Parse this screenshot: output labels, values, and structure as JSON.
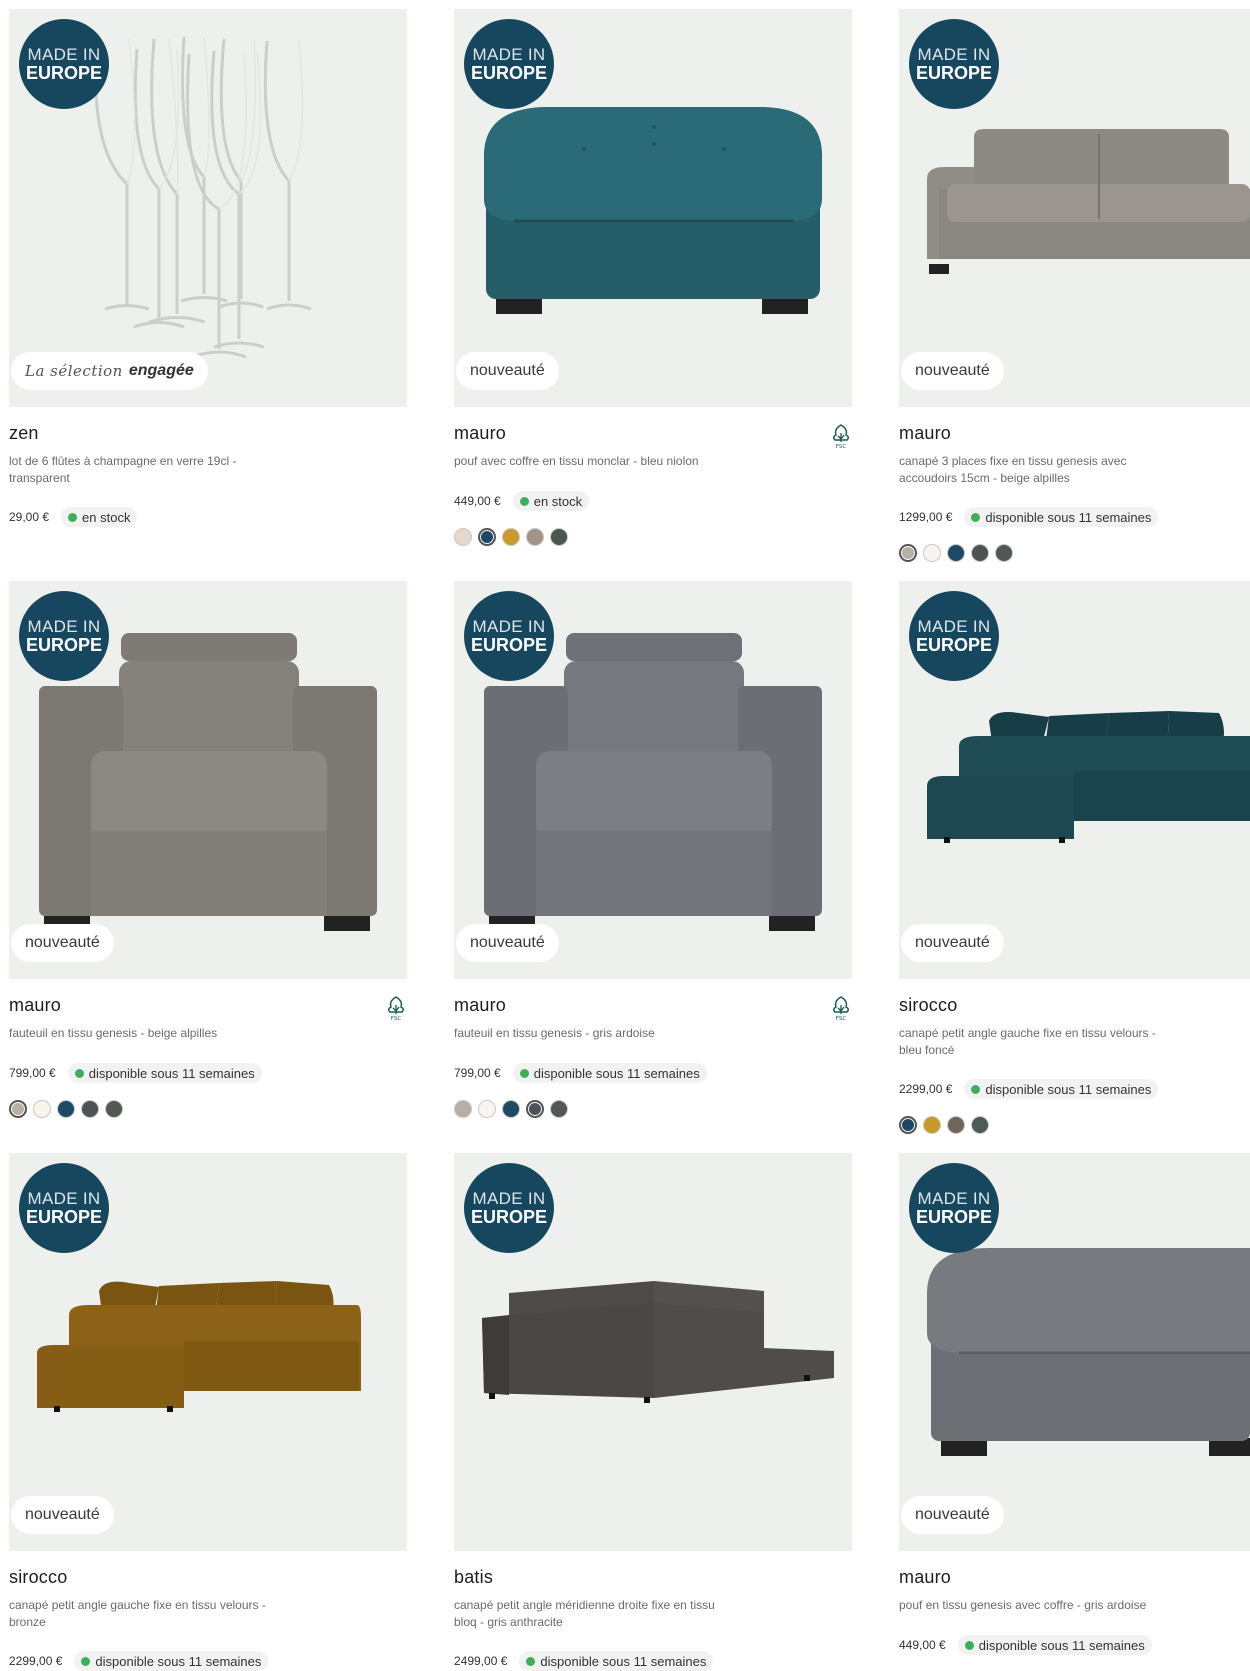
{
  "badges": {
    "europe_line1": "MADE IN",
    "europe_line2": "EUROPE",
    "new": "nouveauté",
    "selection_script": "La sélection",
    "selection_bold": "engagée"
  },
  "products": [
    {
      "name": "zen",
      "desc": "lot de 6 flûtes à champagne en verre 19cl - transparent",
      "price": "29,00 €",
      "availability": "en stock",
      "swatches": []
    },
    {
      "name": "mauro",
      "desc": "pouf avec coffre en tissu monclar - bleu niolon",
      "price": "449,00 €",
      "availability": "en stock",
      "swatches": [
        "#e6d7cc",
        "#1e4865",
        "#c99a2c",
        "#a39586",
        "#4d5550"
      ]
    },
    {
      "name": "mauro",
      "desc": "canapé 3 places fixe en tissu genesis avec accoudoirs 15cm - beige alpilles",
      "price": "1299,00 €",
      "availability": "disponible sous 11 semaines",
      "swatches": [
        "#b5afa6",
        "#f7f5ee",
        "#1e4a66",
        "#4f5254",
        "#515753"
      ]
    },
    {
      "name": "mauro",
      "desc": "fauteuil en tissu genesis - beige alpilles",
      "price": "799,00 €",
      "availability": "disponible sous 11 semaines",
      "swatches": [
        "#b5afa6",
        "#f7f5ee",
        "#1e4a66",
        "#4f5254",
        "#515753"
      ]
    },
    {
      "name": "mauro",
      "desc": "fauteuil en tissu genesis - gris ardoise",
      "price": "799,00 €",
      "availability": "disponible sous 11 semaines",
      "swatches": [
        "#b5afa6",
        "#f7f5ee",
        "#1e4a66",
        "#4f5254",
        "#515753"
      ]
    },
    {
      "name": "sirocco",
      "desc": "canapé petit angle gauche fixe en tissu velours - bleu foncé",
      "price": "2299,00 €",
      "availability": "disponible sous 11 semaines",
      "swatches": [
        "#1c4661",
        "#c79a2a",
        "#6f6558",
        "#4f5a54"
      ]
    },
    {
      "name": "sirocco",
      "desc": "canapé petit angle gauche fixe en tissu velours - bronze",
      "price": "2299,00 €",
      "availability": "disponible sous 11 semaines",
      "swatches": []
    },
    {
      "name": "batis",
      "desc": "canapé petit angle méridienne droite fixe en tissu bloq - gris anthracite",
      "price": "2499,00 €",
      "availability": "disponible sous 11 semaines",
      "swatches": []
    },
    {
      "name": "mauro",
      "desc": "pouf en tissu genesis avec coffre - gris ardoise",
      "price": "449,00 €",
      "availability": "disponible sous 11 semaines",
      "swatches": []
    }
  ],
  "colors": {
    "badge": "#17475f",
    "image_bg": "#eef0ed",
    "stock_dot": "#3fae5a"
  }
}
